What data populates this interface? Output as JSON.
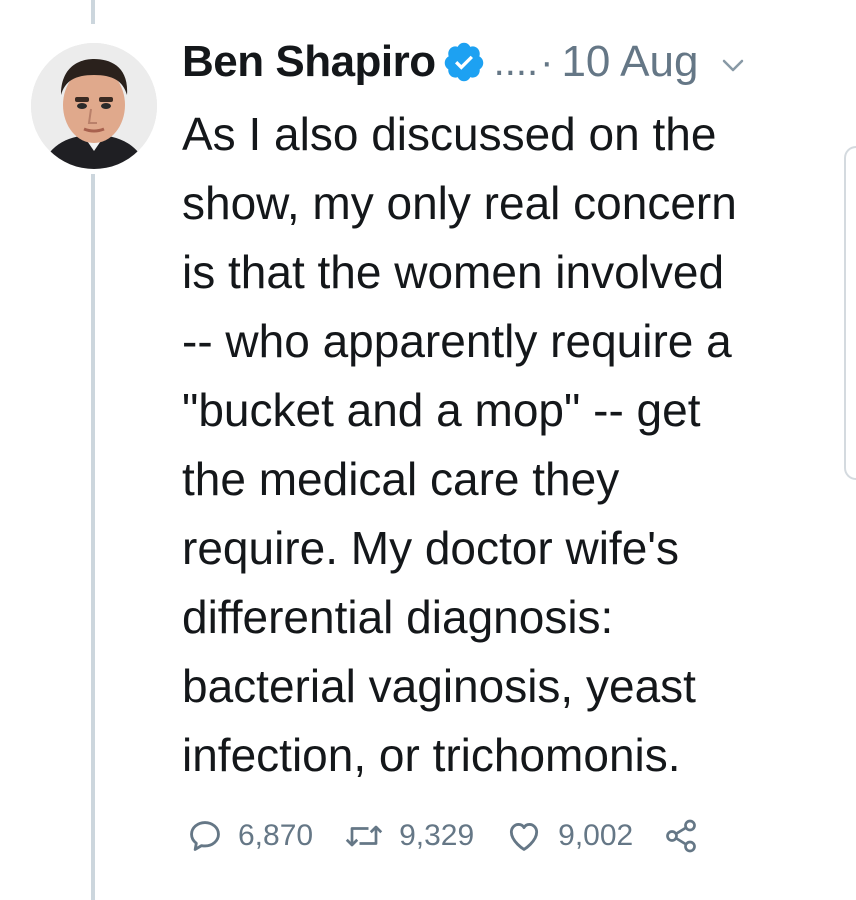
{
  "tweet": {
    "author_name": "Ben Shapiro",
    "handle_truncated": "....",
    "separator": "·",
    "date": "10 Aug",
    "body_lines": [
      "As I also discussed on the",
      "show, my only real concern",
      "is that the women involved",
      "-- who apparently require a",
      "\"bucket and a mop\" -- get",
      "the medical care they",
      "require. My doctor wife's",
      "differential diagnosis:",
      "bacterial vaginosis, yeast",
      "infection, or trichomonis."
    ],
    "stats": {
      "replies": "6,870",
      "retweets": "9,329",
      "likes": "9,002"
    }
  },
  "icons": {
    "verified": "verified-badge-icon",
    "caret": "chevron-down-icon",
    "reply": "reply-icon",
    "retweet": "retweet-icon",
    "like": "heart-icon",
    "share": "share-icon"
  },
  "colors": {
    "text": "#14171a",
    "muted": "#657786",
    "verified_blue": "#1da1f2",
    "thread_line": "#ccd6dd"
  }
}
